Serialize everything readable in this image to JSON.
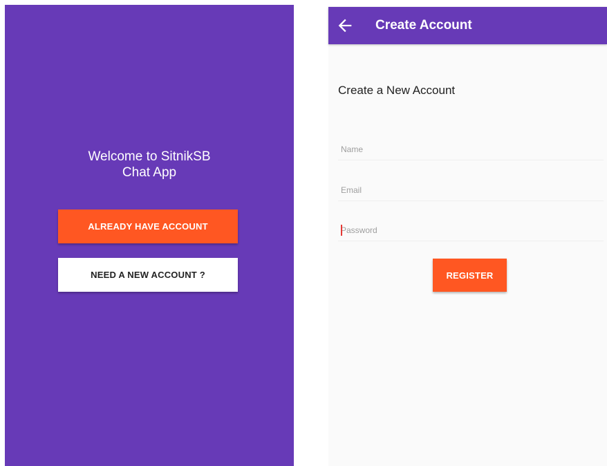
{
  "welcome_screen": {
    "title_line1": "Welcome to SitnikSB",
    "title_line2": "Chat App",
    "login_button_label": "ALREADY HAVE ACCOUNT",
    "register_button_label": "NEED A NEW ACCOUNT ?",
    "background_color": "#673ab7"
  },
  "register_screen": {
    "appbar": {
      "title": "Create Account",
      "back_icon": "arrow-left-icon"
    },
    "heading": "Create a New Account",
    "fields": {
      "name_placeholder": "Name",
      "email_placeholder": "Email",
      "password_placeholder": "Password"
    },
    "register_button_label": "REGISTER"
  },
  "colors": {
    "primary": "#673ab7",
    "accent": "#ff5722",
    "surface": "#fafafa",
    "button_light": "#ffffff"
  }
}
